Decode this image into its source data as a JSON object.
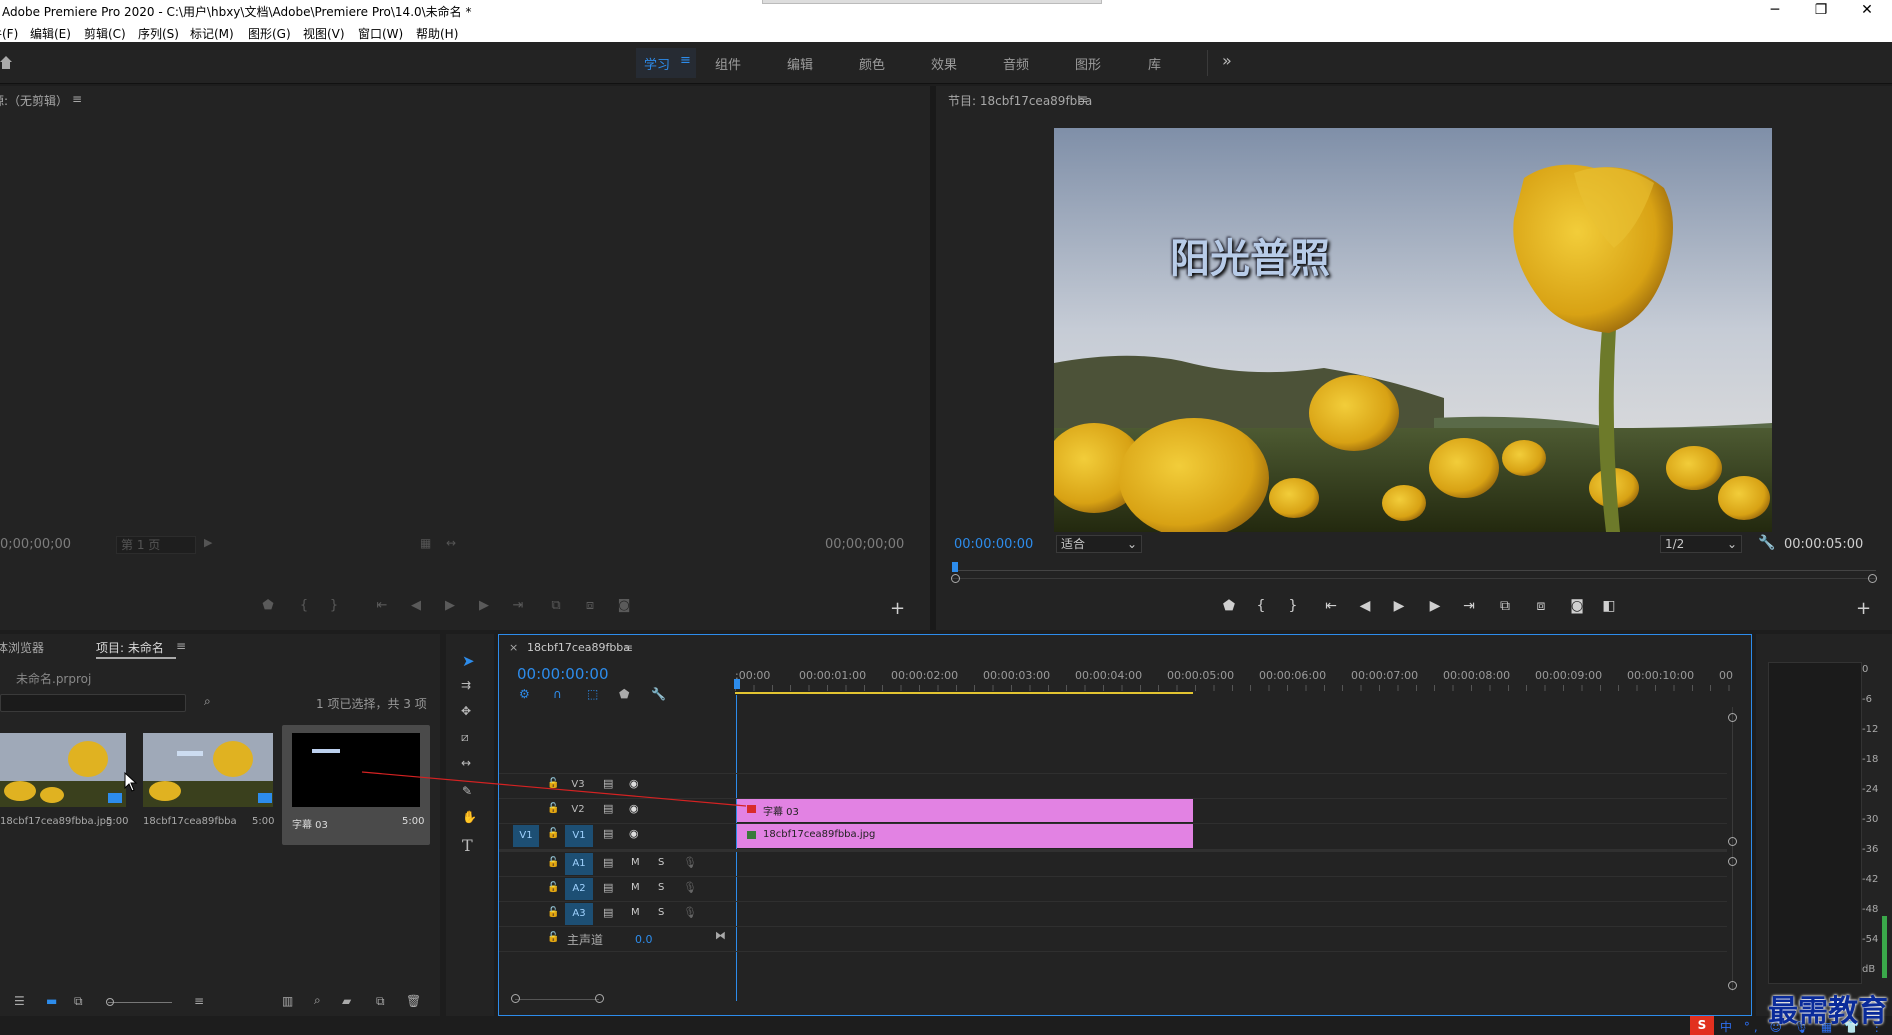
{
  "app": {
    "title": "Adobe Premiere Pro 2020 - C:\\用户\\hbxy\\文档\\Adobe\\Premiere Pro\\14.0\\未命名 *",
    "window_controls": [
      "─",
      "❐",
      "✕"
    ]
  },
  "menu": {
    "items": [
      "文件(F)",
      "编辑(E)",
      "剪辑(C)",
      "序列(S)",
      "标记(M)",
      "图形(G)",
      "视图(V)",
      "窗口(W)",
      "帮助(H)"
    ]
  },
  "workspaces": {
    "tabs": [
      "学习",
      "组件",
      "编辑",
      "颜色",
      "效果",
      "音频",
      "图形",
      "库"
    ],
    "active": "学习",
    "more": "»"
  },
  "source_monitor": {
    "title": "源:（无剪辑）",
    "timecode_left": "0;00;00;00",
    "timecode_right": "00;00;00;00",
    "page_select": "第 1 页"
  },
  "program_monitor": {
    "title": "节目: 18cbf17cea89fbba",
    "timecode": "00:00:00:00",
    "duration": "00:00:05:00",
    "zoom": "适合",
    "resolution": "1/2",
    "overlay_text": "阳光普照"
  },
  "project_panel": {
    "tab_media_browser": "媒体浏览器",
    "tab_project": "项目: 未命名",
    "project_file": "未命名.prproj",
    "selection_info": "1 项已选择，共 3 项",
    "items": [
      {
        "name": "18cbf17cea89fbba.jpg",
        "duration": "5:00"
      },
      {
        "name": "18cbf17cea89fbba",
        "duration": "5:00"
      },
      {
        "name": "字幕 03",
        "duration": "5:00"
      }
    ]
  },
  "timeline": {
    "sequence_name": "18cbf17cea89fbba",
    "timecode": "00:00:00:00",
    "ruler": [
      ":00:00",
      "00:00:01:00",
      "00:00:02:00",
      "00:00:03:00",
      "00:00:04:00",
      "00:00:05:00",
      "00:00:06:00",
      "00:00:07:00",
      "00:00:08:00",
      "00:00:09:00",
      "00:00:10:00",
      "00"
    ],
    "video_tracks": [
      "V3",
      "V2",
      "V1"
    ],
    "source_patch": "V1",
    "audio_tracks": [
      "A1",
      "A2",
      "A3"
    ],
    "master_label": "主声道",
    "master_value": "0.0",
    "mute_label": "M",
    "solo_label": "S",
    "clips": [
      {
        "track": "V2",
        "name": "字幕 03"
      },
      {
        "track": "V1",
        "name": "18cbf17cea89fbba.jpg"
      }
    ]
  },
  "audio_meter": {
    "scale": [
      "0",
      "-6",
      "-12",
      "-18",
      "-24",
      "-30",
      "-36",
      "-42",
      "-48",
      "-54",
      "dB"
    ]
  },
  "watermark": "最需教育",
  "colors": {
    "accent": "#2d8ceb",
    "clip": "#e282e3",
    "panel": "#232323",
    "bg": "#1d1d1d"
  }
}
